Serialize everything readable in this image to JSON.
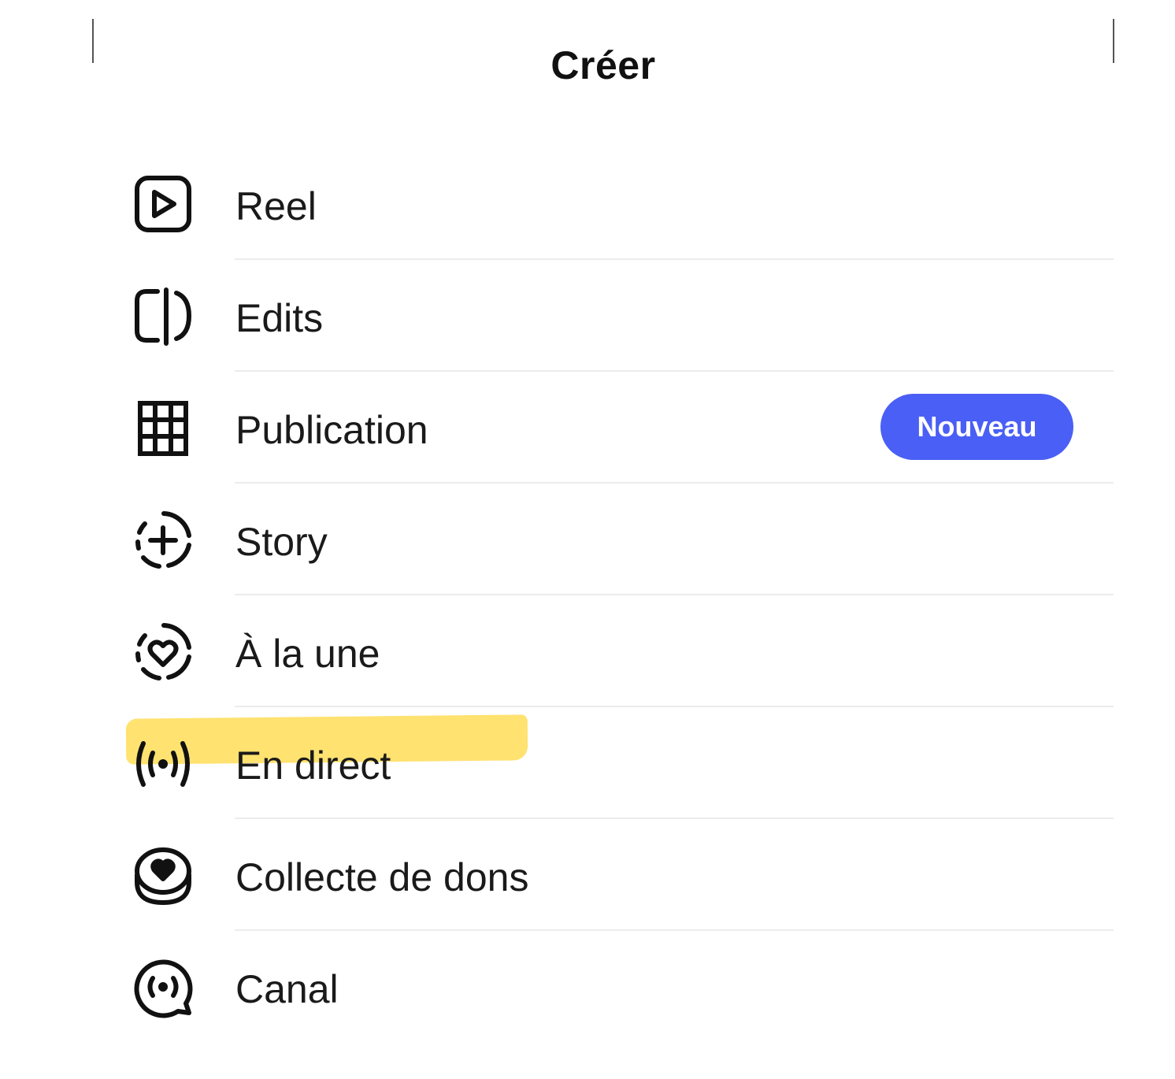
{
  "header": {
    "title": "Créer"
  },
  "menu": {
    "items": [
      {
        "label": "Reel",
        "icon": "reel-icon"
      },
      {
        "label": "Edits",
        "icon": "edits-icon",
        "badge": "Nouveau"
      },
      {
        "label": "Publication",
        "icon": "grid-icon"
      },
      {
        "label": "Story",
        "icon": "story-add-icon"
      },
      {
        "label": "À la une",
        "icon": "highlight-heart-icon"
      },
      {
        "label": "En direct",
        "icon": "live-broadcast-icon",
        "highlighted": true
      },
      {
        "label": "Collecte de dons",
        "icon": "fundraiser-heart-icon"
      },
      {
        "label": "Canal",
        "icon": "channel-broadcast-icon"
      }
    ]
  },
  "colors": {
    "badge": "#4a5ff5",
    "highlight": "#ffdd57",
    "text": "#1a1a1a"
  }
}
